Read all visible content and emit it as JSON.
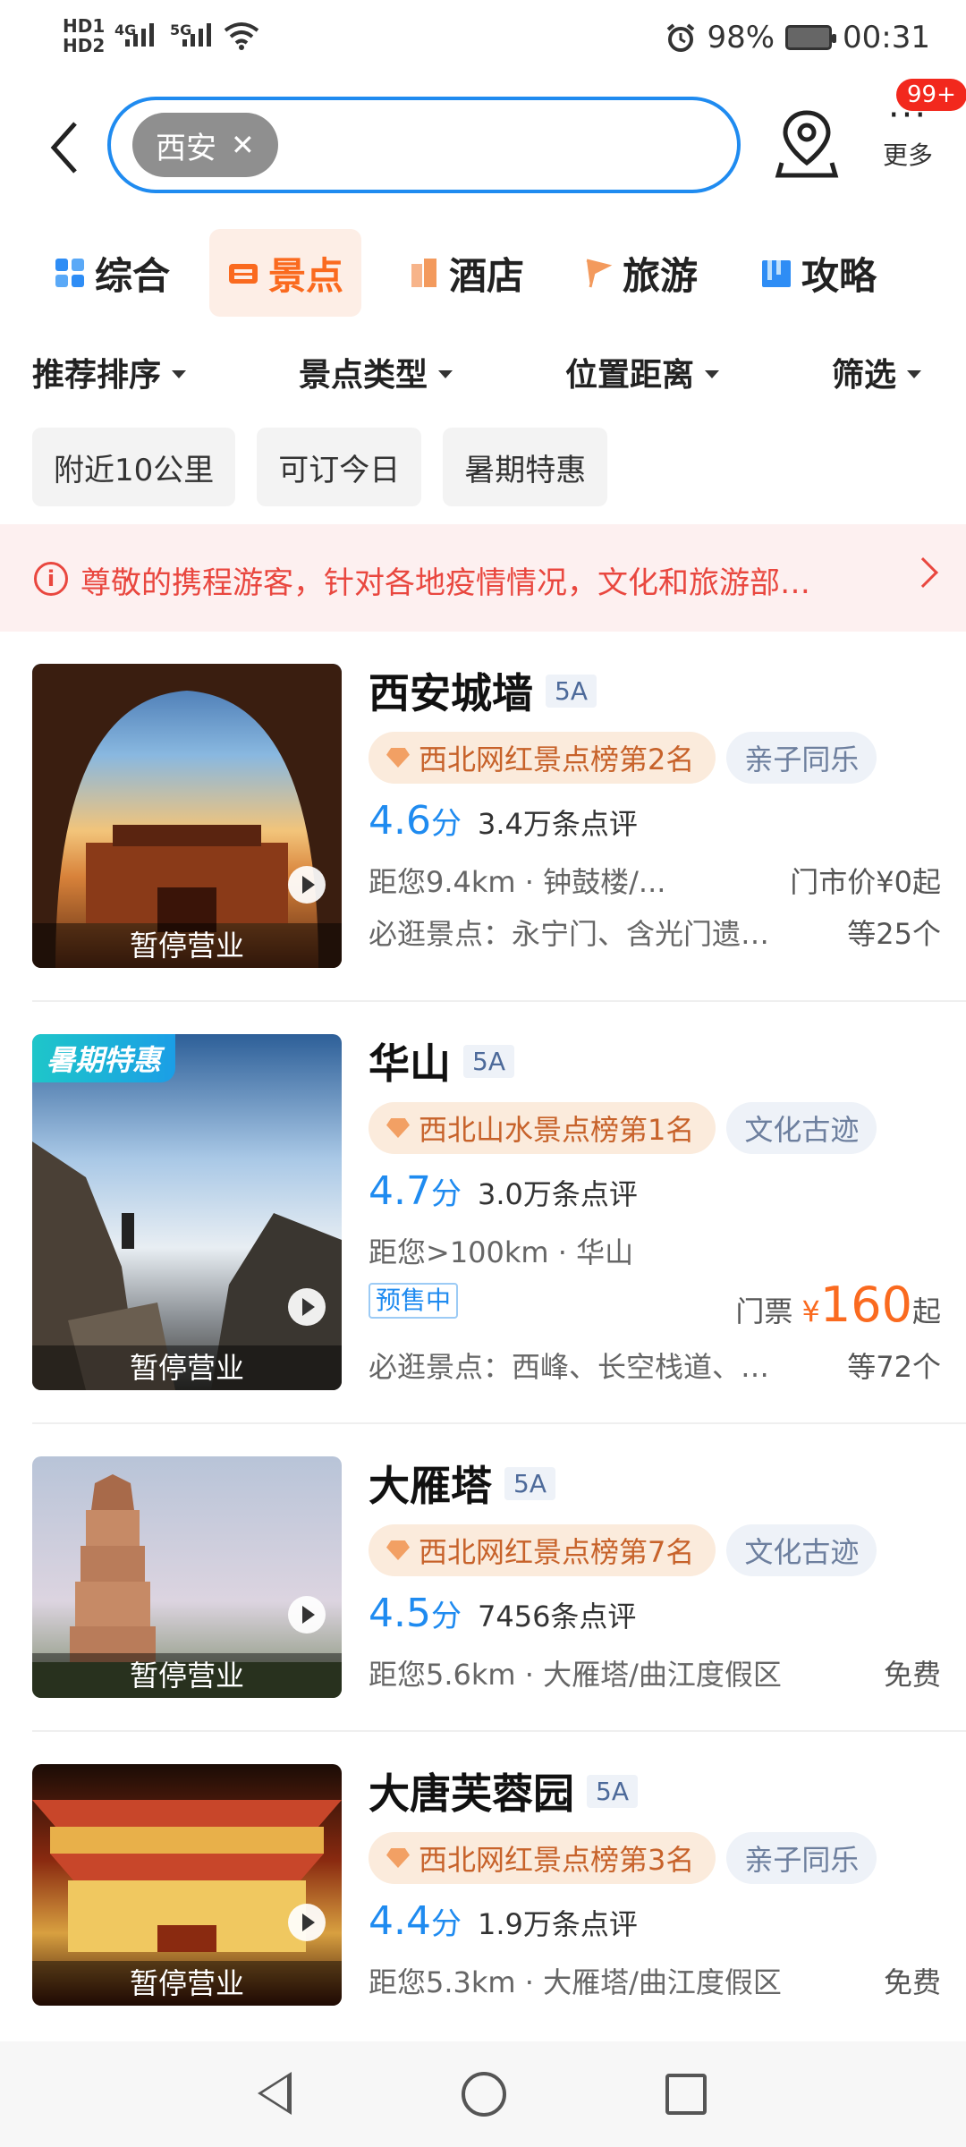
{
  "status_bar": {
    "hd1": "HD1",
    "hd2": "HD2",
    "net1": "4G",
    "net2": "5G",
    "battery": "98%",
    "time": "00:31"
  },
  "header": {
    "search_chip": "西安",
    "more_label": "更多",
    "more_badge": "99+"
  },
  "tabs": [
    {
      "label": "综合",
      "icon": "grid-icon",
      "color": "#2e8df5"
    },
    {
      "label": "景点",
      "icon": "ticket-icon",
      "color": "#fa6a1f"
    },
    {
      "label": "酒店",
      "icon": "building-icon",
      "color": "#f39a5d"
    },
    {
      "label": "旅游",
      "icon": "flag-icon",
      "color": "#f39a5d"
    },
    {
      "label": "攻略",
      "icon": "book-icon",
      "color": "#2e8df5"
    }
  ],
  "sorts": [
    "推荐排序",
    "景点类型",
    "位置距离",
    "筛选"
  ],
  "filters": [
    "附近10公里",
    "可订今日",
    "暑期特惠"
  ],
  "notice": "尊敬的携程游客，针对各地疫情情况，文化和旅游部…",
  "items": [
    {
      "title": "西安城墙",
      "level": "5A",
      "rank": "西北网红景点榜第2名",
      "category": "亲子同乐",
      "score": "4.6",
      "score_unit": "分",
      "reviews": "3.4万条点评",
      "distance": "距您9.4km · 钟鼓楼/...",
      "price": "门市价¥0起",
      "must_see": "必逛景点：永宁门、含光门遗…",
      "must_count": "等25个",
      "closed": "暂停营业"
    },
    {
      "title": "华山",
      "level": "5A",
      "rank": "西北山水景点榜第1名",
      "category": "文化古迹",
      "score": "4.7",
      "score_unit": "分",
      "reviews": "3.0万条点评",
      "distance": "距您>100km · 华山",
      "presale": "预售中",
      "price_prefix": "门票",
      "price_symbol": "¥",
      "price_value": "160",
      "price_suffix": "起",
      "must_see": "必逛景点：西峰、长空栈道、…",
      "must_count": "等72个",
      "closed": "暂停营业",
      "promo": "暑期特惠"
    },
    {
      "title": "大雁塔",
      "level": "5A",
      "rank": "西北网红景点榜第7名",
      "category": "文化古迹",
      "score": "4.5",
      "score_unit": "分",
      "reviews": "7456条点评",
      "distance": "距您5.6km · 大雁塔/曲江度假区",
      "price": "免费",
      "closed": "暂停营业"
    },
    {
      "title": "大唐芙蓉园",
      "level": "5A",
      "rank": "西北网红景点榜第3名",
      "category": "亲子同乐",
      "score": "4.4",
      "score_unit": "分",
      "reviews": "1.9万条点评",
      "distance": "距您5.3km · 大雁塔/曲江度假区",
      "price": "免费",
      "closed": "暂停营业"
    }
  ]
}
